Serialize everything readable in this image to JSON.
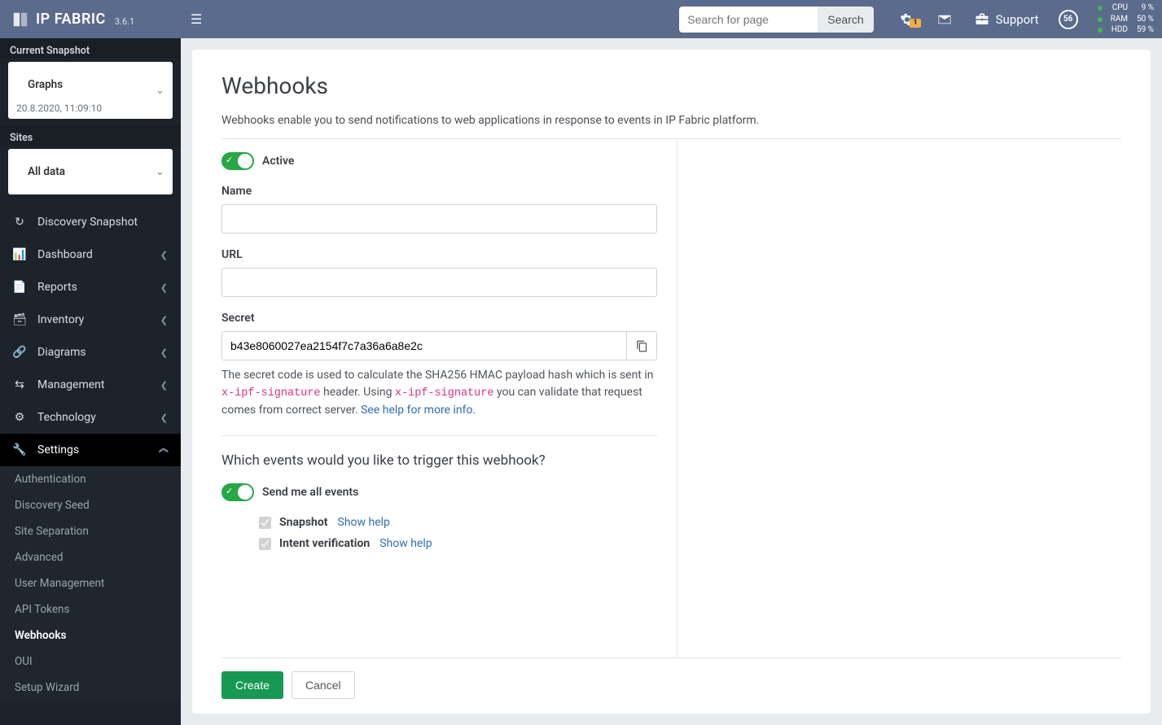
{
  "brand": {
    "name": "IP FABRIC",
    "version": "3.6.1"
  },
  "topbar": {
    "search_placeholder": "Search for page",
    "search_button": "Search",
    "notifications_badge": "1",
    "support_label": "Support",
    "avatar_initials": "56",
    "stats": {
      "cpu_label": "CPU",
      "cpu_value": "9 %",
      "ram_label": "RAM",
      "ram_value": "50 %",
      "hdd_label": "HDD",
      "hdd_value": "59 %"
    }
  },
  "sidebar": {
    "current_snapshot_label": "Current Snapshot",
    "snapshot_select": {
      "title": "Graphs",
      "subtitle": "20.8.2020, 11:09:10"
    },
    "sites_label": "Sites",
    "sites_select": "All data",
    "nav": [
      {
        "label": "Discovery Snapshot"
      },
      {
        "label": "Dashboard"
      },
      {
        "label": "Reports"
      },
      {
        "label": "Inventory"
      },
      {
        "label": "Diagrams"
      },
      {
        "label": "Management"
      },
      {
        "label": "Technology"
      },
      {
        "label": "Settings"
      }
    ],
    "settings_sub": [
      {
        "label": "Authentication"
      },
      {
        "label": "Discovery Seed"
      },
      {
        "label": "Site Separation"
      },
      {
        "label": "Advanced"
      },
      {
        "label": "User Management"
      },
      {
        "label": "API Tokens"
      },
      {
        "label": "Webhooks"
      },
      {
        "label": "OUI"
      },
      {
        "label": "Setup Wizard"
      }
    ]
  },
  "page": {
    "title": "Webhooks",
    "description": "Webhooks enable you to send notifications to web applications in response to events in IP Fabric platform.",
    "active_label": "Active",
    "name_label": "Name",
    "name_value": "",
    "url_label": "URL",
    "url_value": "",
    "secret_label": "Secret",
    "secret_value": "b43e8060027ea2154f7c7a36a6a8e2c",
    "secret_help_pre": "The secret code is used to calculate the SHA256 HMAC payload hash which is sent in ",
    "secret_code1": "x-ipf-signature",
    "secret_help_mid": " header. Using ",
    "secret_code2": "x-ipf-signature",
    "secret_help_post": " you can validate that request comes from correct server. ",
    "secret_help_link": "See help for more info",
    "events_title": "Which events would you like to trigger this webhook?",
    "send_all_label": "Send me all events",
    "snapshot_label": "Snapshot",
    "intent_label": "Intent verification",
    "show_help": "Show help",
    "create_button": "Create",
    "cancel_button": "Cancel"
  }
}
